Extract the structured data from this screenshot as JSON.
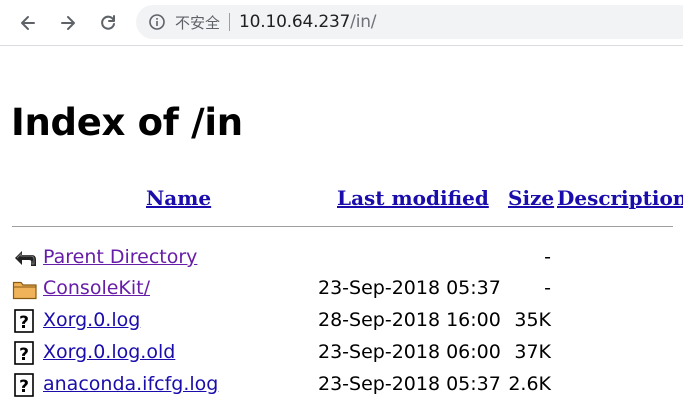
{
  "browser": {
    "security_label": "不安全",
    "url_host": "10.10.64.237",
    "url_path": "/in/"
  },
  "page": {
    "title": "Index of /in",
    "columns": {
      "name": "Name",
      "last_modified": "Last modified",
      "size": "Size",
      "description": "Description"
    },
    "entries": [
      {
        "name": "Parent Directory",
        "date": "",
        "size": "-",
        "icon": "back-icon",
        "visited": true
      },
      {
        "name": "ConsoleKit/",
        "date": "23-Sep-2018 05:37",
        "size": "-",
        "icon": "folder-icon",
        "visited": true
      },
      {
        "name": "Xorg.0.log",
        "date": "28-Sep-2018 16:00",
        "size": "35K",
        "icon": "unknown-file-icon",
        "visited": false
      },
      {
        "name": "Xorg.0.log.old",
        "date": "23-Sep-2018 06:00",
        "size": "37K",
        "icon": "unknown-file-icon",
        "visited": false
      },
      {
        "name": "anaconda.ifcfg.log",
        "date": "23-Sep-2018 05:37",
        "size": "2.6K",
        "icon": "unknown-file-icon",
        "visited": false
      }
    ]
  },
  "colors": {
    "link": "#1a0dab",
    "visited_link": "#681da8",
    "toolbar_bg": "#ffffff",
    "omnibox_bg": "#f1f3f4"
  }
}
